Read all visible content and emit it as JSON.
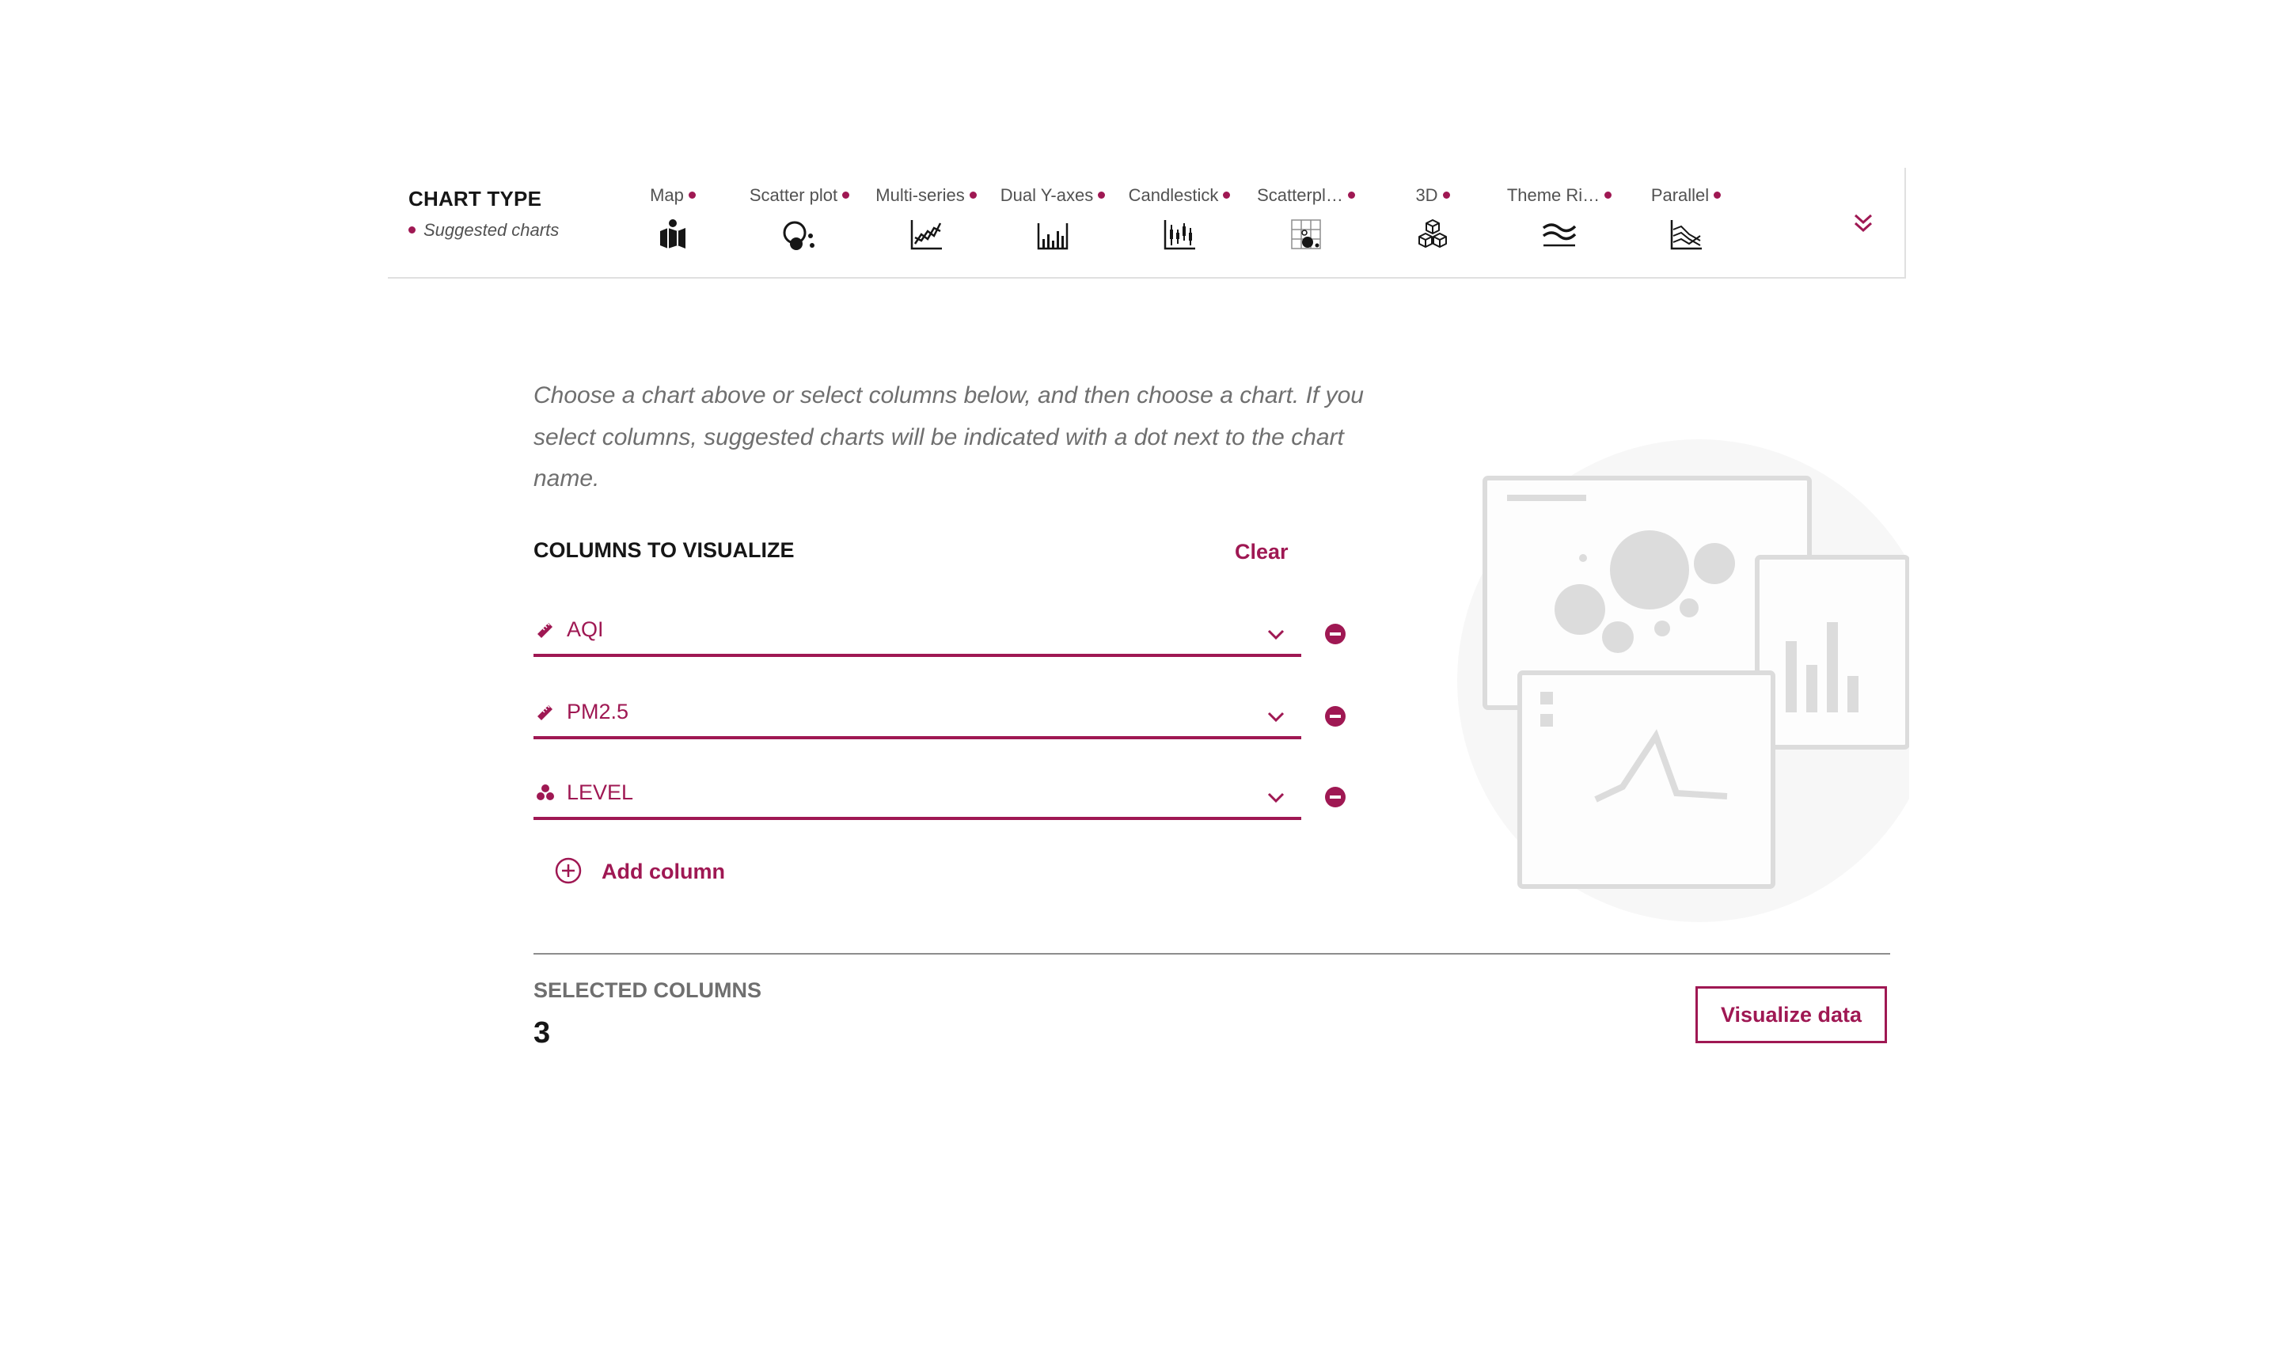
{
  "chart_type": {
    "title": "CHART TYPE",
    "subtitle": "Suggested charts",
    "items": [
      {
        "label": "Map",
        "icon": "map-icon",
        "suggested": true
      },
      {
        "label": "Scatter plot",
        "icon": "scatter-plot-icon",
        "suggested": true
      },
      {
        "label": "Multi-series",
        "icon": "multi-series-icon",
        "suggested": true
      },
      {
        "label": "Dual Y-axes",
        "icon": "dual-y-axes-icon",
        "suggested": true
      },
      {
        "label": "Candlestick",
        "icon": "candlestick-icon",
        "suggested": true
      },
      {
        "label": "Scatterpl…",
        "icon": "scatterplot-matrix-icon",
        "suggested": true
      },
      {
        "label": "3D",
        "icon": "3d-icon",
        "suggested": true
      },
      {
        "label": "Theme Ri…",
        "icon": "theme-river-icon",
        "suggested": true
      },
      {
        "label": "Parallel",
        "icon": "parallel-icon",
        "suggested": true
      }
    ],
    "expand_icon": "double-chevron-down-icon"
  },
  "instructions": "Choose a chart above or select columns below, and then choose a chart. If you select columns, suggested charts will be indicated with a dot next to the chart name.",
  "columns": {
    "heading": "COLUMNS TO VISUALIZE",
    "clear_label": "Clear",
    "items": [
      {
        "name": "AQI",
        "icon": "ruler-icon"
      },
      {
        "name": "PM2.5",
        "icon": "ruler-icon"
      },
      {
        "name": "LEVEL",
        "icon": "categorical-icon"
      }
    ],
    "add_label": "Add column"
  },
  "selected": {
    "label": "SELECTED COLUMNS",
    "count": "3"
  },
  "visualize_label": "Visualize data",
  "colors": {
    "accent": "#9f1853",
    "text": "#161616",
    "muted": "#6f6f6f",
    "illustration": "#dcdcdc"
  }
}
